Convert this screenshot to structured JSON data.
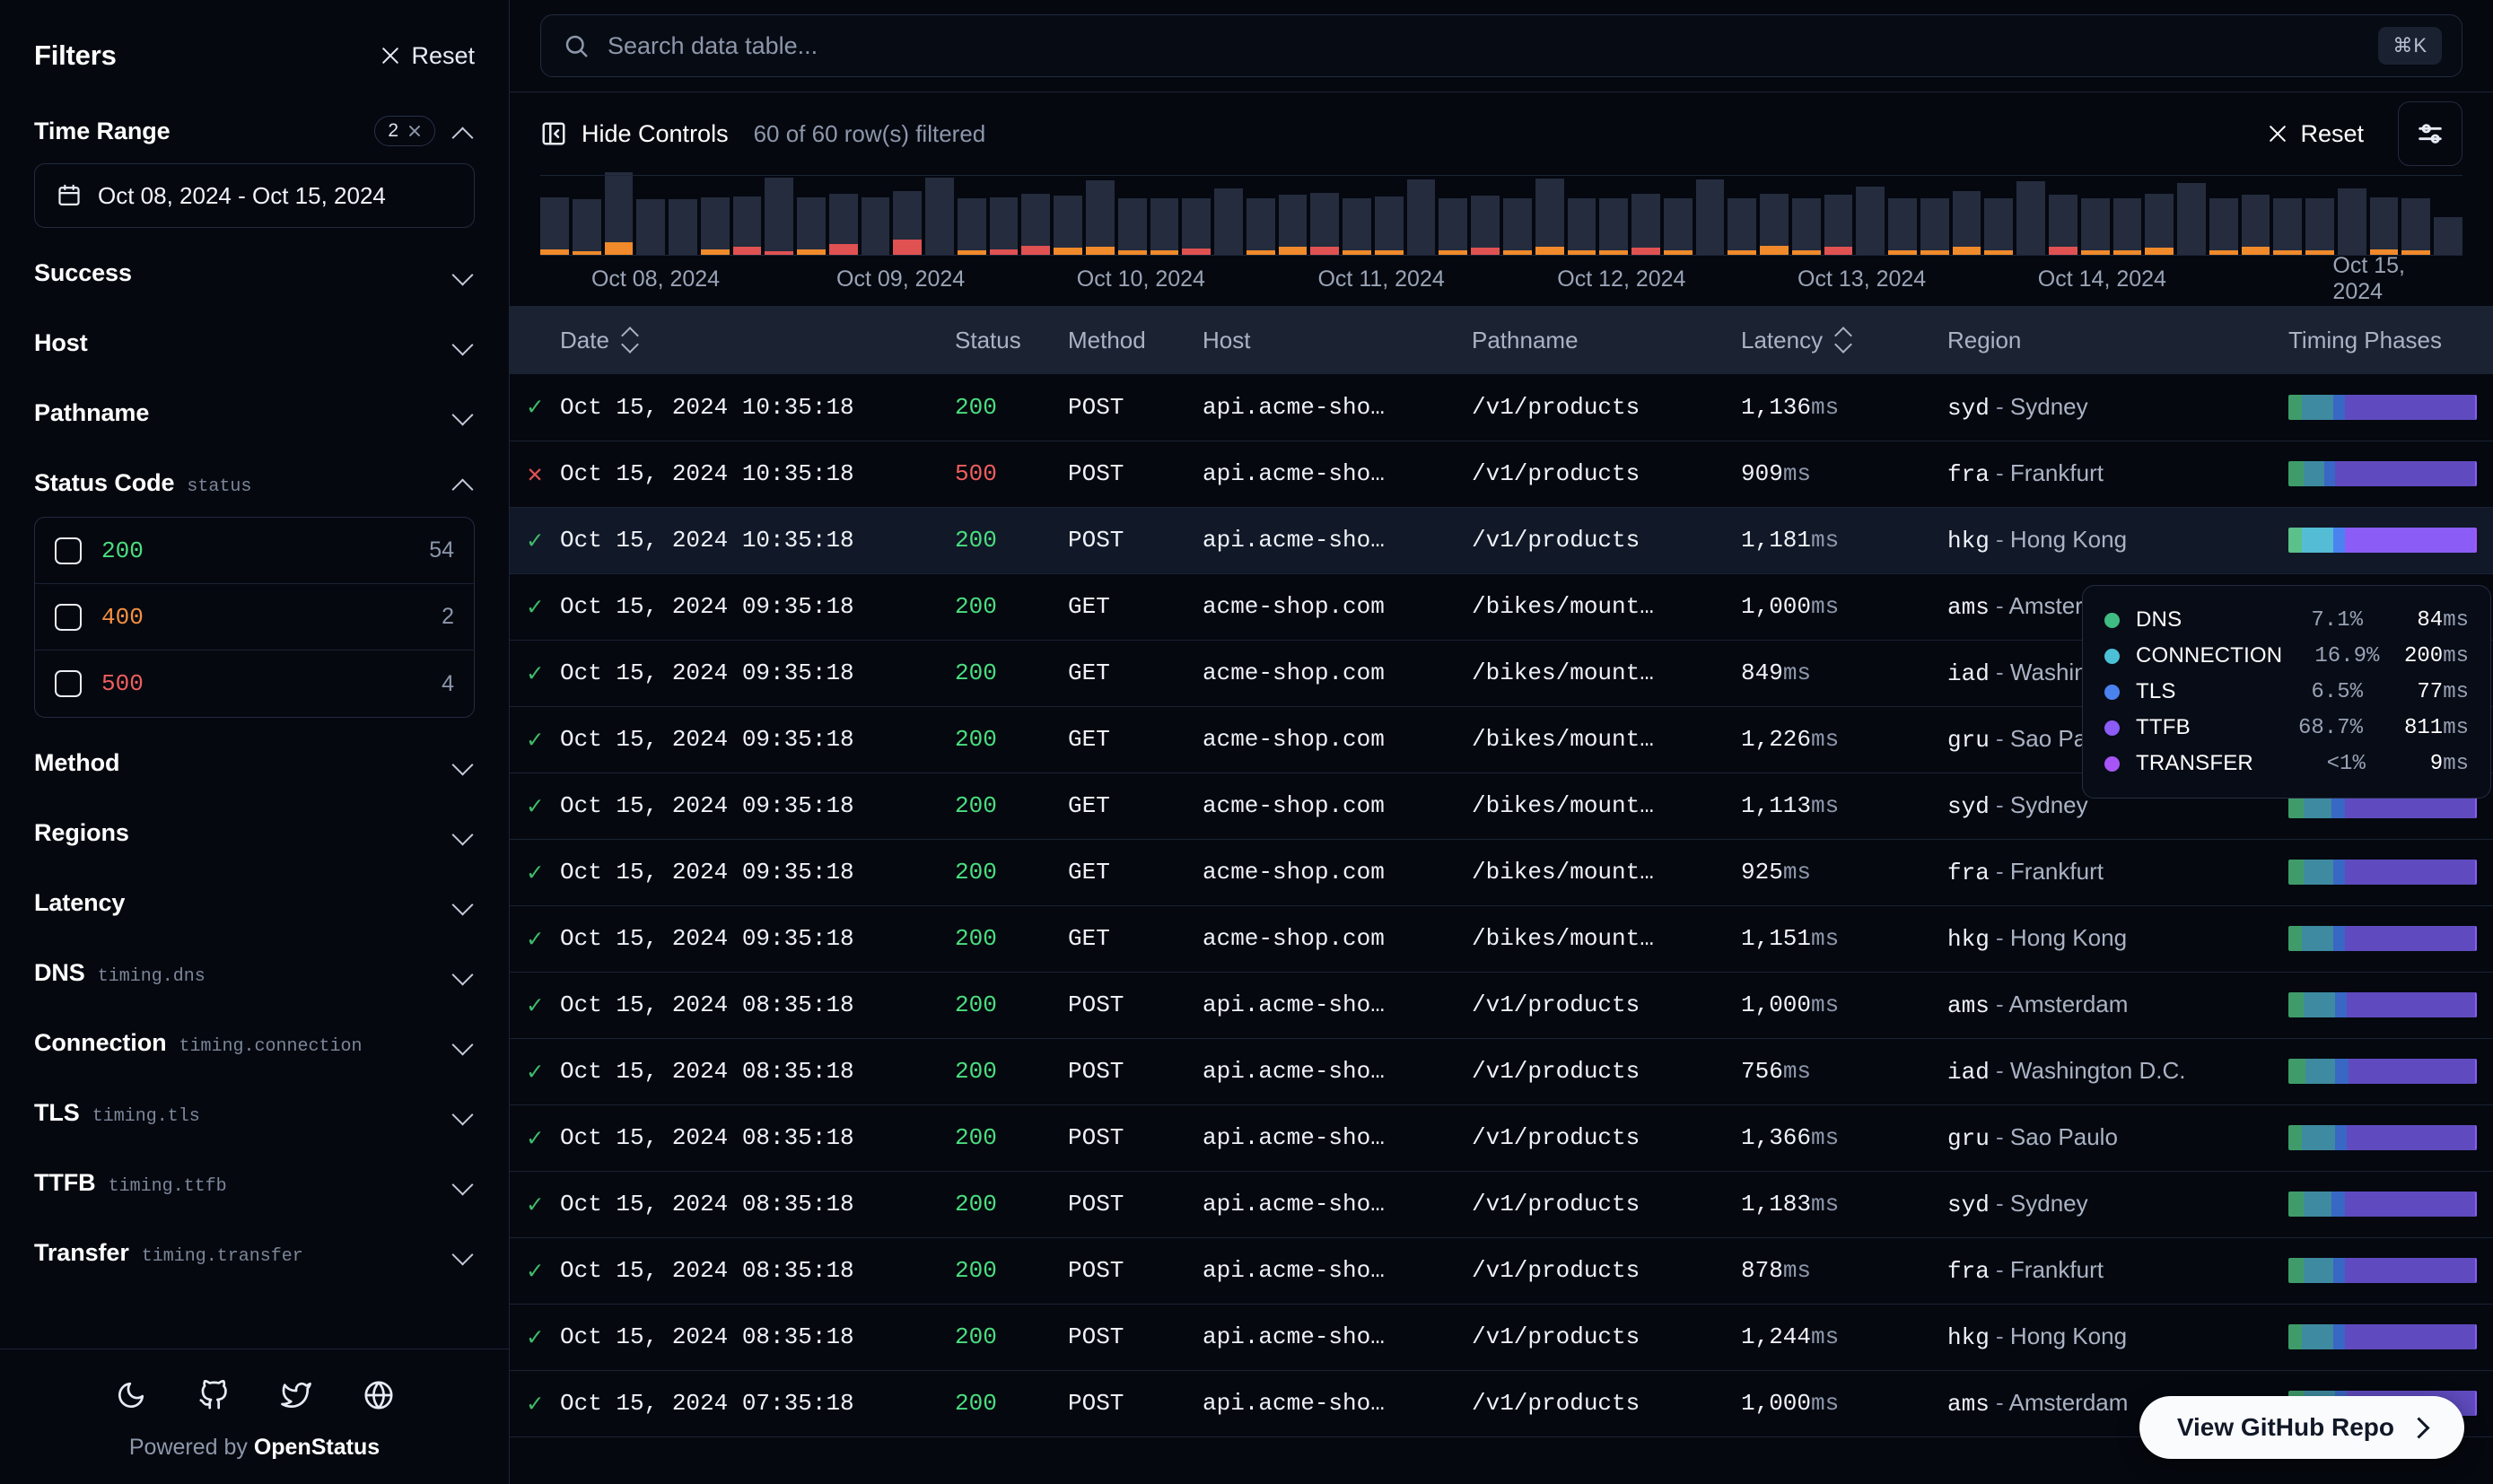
{
  "sidebar": {
    "title": "Filters",
    "reset_label": "Reset",
    "groups": [
      {
        "name": "Time Range",
        "sub": "",
        "badge_count": "2",
        "expanded": true
      },
      {
        "name": "Success",
        "sub": "",
        "badge_count": "",
        "expanded": false
      },
      {
        "name": "Host",
        "sub": "",
        "badge_count": "",
        "expanded": false
      },
      {
        "name": "Pathname",
        "sub": "",
        "badge_count": "",
        "expanded": false
      },
      {
        "name": "Status Code",
        "sub": "status",
        "badge_count": "",
        "expanded": true
      },
      {
        "name": "Method",
        "sub": "",
        "badge_count": "",
        "expanded": false
      },
      {
        "name": "Regions",
        "sub": "",
        "badge_count": "",
        "expanded": false
      },
      {
        "name": "Latency",
        "sub": "",
        "badge_count": "",
        "expanded": false
      },
      {
        "name": "DNS",
        "sub": "timing.dns",
        "badge_count": "",
        "expanded": false
      },
      {
        "name": "Connection",
        "sub": "timing.connection",
        "badge_count": "",
        "expanded": false
      },
      {
        "name": "TLS",
        "sub": "timing.tls",
        "badge_count": "",
        "expanded": false
      },
      {
        "name": "TTFB",
        "sub": "timing.ttfb",
        "badge_count": "",
        "expanded": false
      },
      {
        "name": "Transfer",
        "sub": "timing.transfer",
        "badge_count": "",
        "expanded": false
      }
    ],
    "date_range_value": "Oct 08, 2024 - Oct 15, 2024",
    "status_codes": [
      {
        "code": "200",
        "count": "54",
        "color": "#4ade80",
        "checked": false
      },
      {
        "code": "400",
        "count": "2",
        "color": "#f59042",
        "checked": false
      },
      {
        "code": "500",
        "count": "4",
        "color": "#ef5e5e",
        "checked": false
      }
    ],
    "footer": {
      "social": [
        "moon-icon",
        "github-icon",
        "twitter-icon",
        "globe-icon"
      ],
      "powered_prefix": "Powered by ",
      "powered_brand": "OpenStatus"
    }
  },
  "search": {
    "placeholder": "Search data table...",
    "value": "",
    "shortcut": "⌘K"
  },
  "controls": {
    "hide_controls_label": "Hide Controls",
    "row_count_label": "60 of 60 row(s) filtered",
    "reset_label": "Reset"
  },
  "chart_data": {
    "type": "bar",
    "title": "",
    "xlabel": "",
    "ylabel": "",
    "grid": false,
    "legend": false,
    "tick_labels": [
      "Oct 08, 2024",
      "Oct 09, 2024",
      "Oct 10, 2024",
      "Oct 11, 2024",
      "Oct 12, 2024",
      "Oct 13, 2024",
      "Oct 14, 2024",
      "Oct 15, 2024"
    ],
    "series": [
      {
        "name": "success",
        "color": "#242c3e"
      },
      {
        "name": "warning",
        "color": "#f08a2b"
      },
      {
        "name": "error",
        "color": "#e05252"
      }
    ],
    "bars": [
      {
        "ok": 58,
        "warn": 6,
        "err": 0
      },
      {
        "ok": 58,
        "warn": 4,
        "err": 0
      },
      {
        "ok": 78,
        "warn": 14,
        "err": 0
      },
      {
        "ok": 62,
        "warn": 0,
        "err": 0
      },
      {
        "ok": 62,
        "warn": 0,
        "err": 0
      },
      {
        "ok": 58,
        "warn": 6,
        "err": 0
      },
      {
        "ok": 56,
        "warn": 0,
        "err": 9
      },
      {
        "ok": 82,
        "warn": 0,
        "err": 4
      },
      {
        "ok": 58,
        "warn": 6,
        "err": 0
      },
      {
        "ok": 56,
        "warn": 0,
        "err": 12
      },
      {
        "ok": 64,
        "warn": 0,
        "err": 0
      },
      {
        "ok": 54,
        "warn": 0,
        "err": 17
      },
      {
        "ok": 86,
        "warn": 0,
        "err": 0
      },
      {
        "ok": 58,
        "warn": 5,
        "err": 0
      },
      {
        "ok": 58,
        "warn": 0,
        "err": 6
      },
      {
        "ok": 58,
        "warn": 0,
        "err": 10
      },
      {
        "ok": 58,
        "warn": 8,
        "err": 0
      },
      {
        "ok": 74,
        "warn": 9,
        "err": 0
      },
      {
        "ok": 58,
        "warn": 5,
        "err": 0
      },
      {
        "ok": 58,
        "warn": 5,
        "err": 0
      },
      {
        "ok": 56,
        "warn": 0,
        "err": 7
      },
      {
        "ok": 74,
        "warn": 0,
        "err": 0
      },
      {
        "ok": 58,
        "warn": 5,
        "err": 0
      },
      {
        "ok": 58,
        "warn": 9,
        "err": 0
      },
      {
        "ok": 60,
        "warn": 0,
        "err": 9
      },
      {
        "ok": 58,
        "warn": 5,
        "err": 0
      },
      {
        "ok": 60,
        "warn": 5,
        "err": 0
      },
      {
        "ok": 84,
        "warn": 0,
        "err": 0
      },
      {
        "ok": 58,
        "warn": 5,
        "err": 0
      },
      {
        "ok": 58,
        "warn": 0,
        "err": 8
      },
      {
        "ok": 58,
        "warn": 5,
        "err": 0
      },
      {
        "ok": 76,
        "warn": 9,
        "err": 0
      },
      {
        "ok": 58,
        "warn": 5,
        "err": 0
      },
      {
        "ok": 58,
        "warn": 5,
        "err": 0
      },
      {
        "ok": 60,
        "warn": 0,
        "err": 8
      },
      {
        "ok": 58,
        "warn": 5,
        "err": 0
      },
      {
        "ok": 84,
        "warn": 0,
        "err": 0
      },
      {
        "ok": 58,
        "warn": 5,
        "err": 0
      },
      {
        "ok": 58,
        "warn": 10,
        "err": 0
      },
      {
        "ok": 58,
        "warn": 5,
        "err": 0
      },
      {
        "ok": 58,
        "warn": 0,
        "err": 9
      },
      {
        "ok": 76,
        "warn": 0,
        "err": 0
      },
      {
        "ok": 58,
        "warn": 5,
        "err": 0
      },
      {
        "ok": 58,
        "warn": 5,
        "err": 0
      },
      {
        "ok": 62,
        "warn": 9,
        "err": 0
      },
      {
        "ok": 58,
        "warn": 5,
        "err": 0
      },
      {
        "ok": 82,
        "warn": 0,
        "err": 0
      },
      {
        "ok": 58,
        "warn": 0,
        "err": 9
      },
      {
        "ok": 58,
        "warn": 5,
        "err": 0
      },
      {
        "ok": 58,
        "warn": 5,
        "err": 0
      },
      {
        "ok": 60,
        "warn": 8,
        "err": 0
      },
      {
        "ok": 80,
        "warn": 0,
        "err": 0
      },
      {
        "ok": 58,
        "warn": 5,
        "err": 0
      },
      {
        "ok": 58,
        "warn": 9,
        "err": 0
      },
      {
        "ok": 58,
        "warn": 5,
        "err": 0
      },
      {
        "ok": 58,
        "warn": 5,
        "err": 0
      },
      {
        "ok": 74,
        "warn": 0,
        "err": 0
      },
      {
        "ok": 58,
        "warn": 6,
        "err": 0
      },
      {
        "ok": 58,
        "warn": 5,
        "err": 0
      },
      {
        "ok": 42,
        "warn": 0,
        "err": 0
      }
    ]
  },
  "table": {
    "columns": [
      {
        "label": "",
        "key": "ok_icon",
        "sortable": false
      },
      {
        "label": "Date",
        "key": "date",
        "sortable": true
      },
      {
        "label": "Status",
        "key": "status",
        "sortable": false
      },
      {
        "label": "Method",
        "key": "method",
        "sortable": false
      },
      {
        "label": "Host",
        "key": "host",
        "sortable": false
      },
      {
        "label": "Pathname",
        "key": "pathname",
        "sortable": false
      },
      {
        "label": "Latency",
        "key": "latency",
        "sortable": true
      },
      {
        "label": "Region",
        "key": "region",
        "sortable": false
      },
      {
        "label": "Timing Phases",
        "key": "phases",
        "sortable": false
      }
    ],
    "rows": [
      {
        "ok": true,
        "date": "Oct 15, 2024 10:35:18",
        "status": "200",
        "method": "POST",
        "host": "api.acme-sho…",
        "pathname": "/v1/products",
        "latency": "1,136",
        "region_code": "syd",
        "region_name": "Sydney",
        "phases": [
          7,
          17,
          6,
          69,
          1
        ]
      },
      {
        "ok": false,
        "date": "Oct 15, 2024 10:35:18",
        "status": "500",
        "method": "POST",
        "host": "api.acme-sho…",
        "pathname": "/v1/products",
        "latency": "909",
        "region_code": "fra",
        "region_name": "Frankfurt",
        "phases": [
          8,
          11,
          6,
          74,
          1
        ]
      },
      {
        "ok": true,
        "date": "Oct 15, 2024 10:35:18",
        "status": "200",
        "method": "POST",
        "host": "api.acme-sho…",
        "pathname": "/v1/products",
        "latency": "1,181",
        "region_code": "hkg",
        "region_name": "Hong Kong",
        "phases": [
          7,
          17,
          6,
          69,
          1
        ]
      },
      {
        "ok": true,
        "date": "Oct 15, 2024 09:35:18",
        "status": "200",
        "method": "GET",
        "host": "acme-shop.com",
        "pathname": "/bikes/mount…",
        "latency": "1,000",
        "region_code": "ams",
        "region_name": "Amsterdam",
        "phases": [
          8,
          17,
          6,
          68,
          1
        ]
      },
      {
        "ok": true,
        "date": "Oct 15, 2024 09:35:18",
        "status": "200",
        "method": "GET",
        "host": "acme-shop.com",
        "pathname": "/bikes/mount…",
        "latency": "849",
        "region_code": "iad",
        "region_name": "Washington D.C.",
        "phases": [
          9,
          16,
          7,
          67,
          1
        ]
      },
      {
        "ok": true,
        "date": "Oct 15, 2024 09:35:18",
        "status": "200",
        "method": "GET",
        "host": "acme-shop.com",
        "pathname": "/bikes/mount…",
        "latency": "1,226",
        "region_code": "gru",
        "region_name": "Sao Paulo",
        "phases": [
          7,
          18,
          6,
          68,
          1
        ]
      },
      {
        "ok": true,
        "date": "Oct 15, 2024 09:35:18",
        "status": "200",
        "method": "GET",
        "host": "acme-shop.com",
        "pathname": "/bikes/mount…",
        "latency": "1,113",
        "region_code": "syd",
        "region_name": "Sydney",
        "phases": [
          8,
          15,
          7,
          69,
          1
        ]
      },
      {
        "ok": true,
        "date": "Oct 15, 2024 09:35:18",
        "status": "200",
        "method": "GET",
        "host": "acme-shop.com",
        "pathname": "/bikes/mount…",
        "latency": "925",
        "region_code": "fra",
        "region_name": "Frankfurt",
        "phases": [
          8,
          16,
          6,
          69,
          1
        ]
      },
      {
        "ok": true,
        "date": "Oct 15, 2024 09:35:18",
        "status": "200",
        "method": "GET",
        "host": "acme-shop.com",
        "pathname": "/bikes/mount…",
        "latency": "1,151",
        "region_code": "hkg",
        "region_name": "Hong Kong",
        "phases": [
          7,
          17,
          6,
          69,
          1
        ]
      },
      {
        "ok": true,
        "date": "Oct 15, 2024 08:35:18",
        "status": "200",
        "method": "POST",
        "host": "api.acme-sho…",
        "pathname": "/v1/products",
        "latency": "1,000",
        "region_code": "ams",
        "region_name": "Amsterdam",
        "phases": [
          8,
          17,
          6,
          68,
          1
        ]
      },
      {
        "ok": true,
        "date": "Oct 15, 2024 08:35:18",
        "status": "200",
        "method": "POST",
        "host": "api.acme-sho…",
        "pathname": "/v1/products",
        "latency": "756",
        "region_code": "iad",
        "region_name": "Washington D.C.",
        "phases": [
          9,
          16,
          7,
          67,
          1
        ]
      },
      {
        "ok": true,
        "date": "Oct 15, 2024 08:35:18",
        "status": "200",
        "method": "POST",
        "host": "api.acme-sho…",
        "pathname": "/v1/products",
        "latency": "1,366",
        "region_code": "gru",
        "region_name": "Sao Paulo",
        "phases": [
          7,
          18,
          6,
          68,
          1
        ]
      },
      {
        "ok": true,
        "date": "Oct 15, 2024 08:35:18",
        "status": "200",
        "method": "POST",
        "host": "api.acme-sho…",
        "pathname": "/v1/products",
        "latency": "1,183",
        "region_code": "syd",
        "region_name": "Sydney",
        "phases": [
          8,
          15,
          7,
          69,
          1
        ]
      },
      {
        "ok": true,
        "date": "Oct 15, 2024 08:35:18",
        "status": "200",
        "method": "POST",
        "host": "api.acme-sho…",
        "pathname": "/v1/products",
        "latency": "878",
        "region_code": "fra",
        "region_name": "Frankfurt",
        "phases": [
          8,
          16,
          6,
          69,
          1
        ]
      },
      {
        "ok": true,
        "date": "Oct 15, 2024 08:35:18",
        "status": "200",
        "method": "POST",
        "host": "api.acme-sho…",
        "pathname": "/v1/products",
        "latency": "1,244",
        "region_code": "hkg",
        "region_name": "Hong Kong",
        "phases": [
          7,
          17,
          6,
          69,
          1
        ]
      },
      {
        "ok": true,
        "date": "Oct 15, 2024 07:35:18",
        "status": "200",
        "method": "POST",
        "host": "api.acme-sho…",
        "pathname": "/v1/products",
        "latency": "1,000",
        "region_code": "ams",
        "region_name": "Amsterdam",
        "phases": [
          8,
          17,
          6,
          68,
          1
        ]
      }
    ],
    "ms_suffix": "ms",
    "phase_colors": [
      "#3f9c6a",
      "#3e8aa0",
      "#3967c4",
      "#5f4bbf",
      "#8b5cf6"
    ]
  },
  "tooltip": {
    "rows": [
      {
        "label": "DNS",
        "pct": "7.1%",
        "ms": "84",
        "color": "#3fbb84"
      },
      {
        "label": "CONNECTION",
        "pct": "16.9%",
        "ms": "200",
        "color": "#4cc0d6"
      },
      {
        "label": "TLS",
        "pct": "6.5%",
        "ms": "77",
        "color": "#4a83f0"
      },
      {
        "label": "TTFB",
        "pct": "68.7%",
        "ms": "811",
        "color": "#8b5cf6"
      },
      {
        "label": "TRANSFER",
        "pct": "<1%",
        "ms": "9",
        "color": "#a855f7"
      }
    ],
    "ms_suffix": "ms"
  },
  "github_pill": {
    "label": "View GitHub Repo"
  }
}
